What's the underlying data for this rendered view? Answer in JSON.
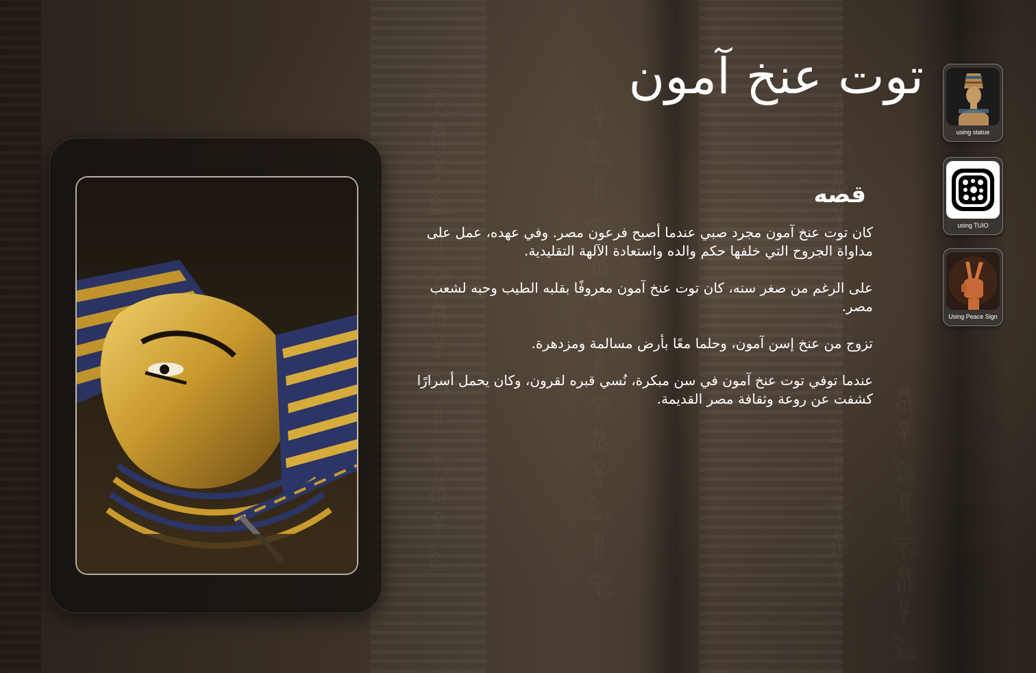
{
  "hero": {
    "title": "توت عنخ آمون",
    "section_heading": "قصه",
    "paragraphs": [
      "كان توت عنخ آمون مجرد صبي عندما أصبح فرعون مصر. وفي عهده، عمل على مداواة الجروح التي خلفها حكم والده واستعادة الآلهة التقليدية.",
      "على الرغم من صغر سنه، كان توت عنخ آمون معروفًا بقلبه الطيب وحبه لشعب مصر.",
      "تزوج من عنخ إسن آمون، وحلما معًا بأرض مسالمة ومزدهرة.",
      "عندما توفي توت عنخ آمون في سن مبكرة، نُسي قبره لقرون، وكان يحمل أسرارًا كشفت عن روعة وثقافة مصر القديمة."
    ]
  },
  "interaction_modes": [
    {
      "label": "using statue",
      "icon": "statue-icon"
    },
    {
      "label": "using TUIO",
      "icon": "tuio-marker-icon"
    },
    {
      "label": "Using Peace Sign",
      "icon": "peace-sign-hand-icon"
    }
  ],
  "colors": {
    "background": "#2b231c",
    "card": "#16110d",
    "text": "#ffffff",
    "mode_card": "#3a3531",
    "gold": "#c99a2e",
    "lapis": "#2b3566"
  }
}
